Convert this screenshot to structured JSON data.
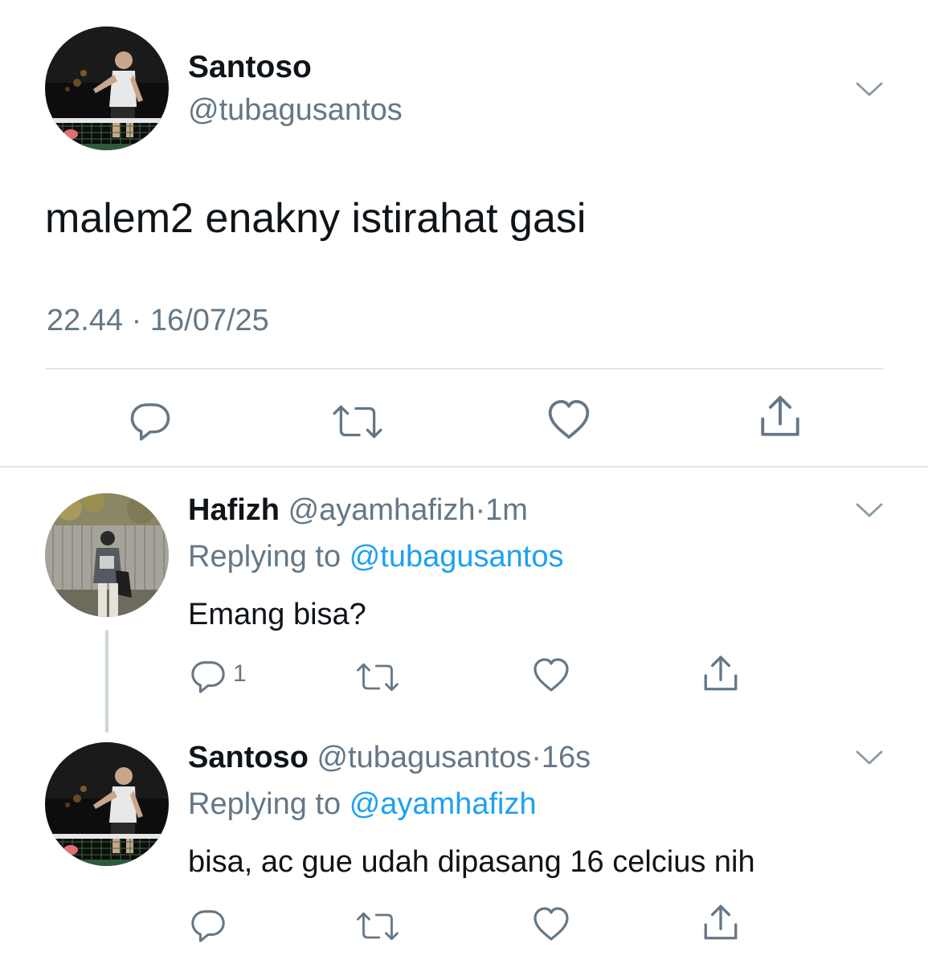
{
  "main_tweet": {
    "name": "Santoso",
    "handle": "@tubagusantos",
    "text": "malem2 enakny istirahat gasi",
    "timestamp": "22.44 · 16/07/25"
  },
  "replies": [
    {
      "name": "Hafizh",
      "handle": "@ayamhafizh",
      "separator": "·",
      "time": "1m",
      "replying_prefix": "Replying to",
      "replying_to": "@tubagusantos",
      "text": "Emang bisa?",
      "reply_count": "1"
    },
    {
      "name": "Santoso",
      "handle": "@tubagusantos",
      "separator": "·",
      "time": "16s",
      "replying_prefix": "Replying to",
      "replying_to": "@ayamhafizh",
      "text": "bisa, ac gue udah dipasang 16 celcius nih",
      "reply_count": ""
    }
  ],
  "icons": [
    "chevron-down-icon",
    "reply-icon",
    "retweet-icon",
    "like-icon",
    "share-icon"
  ],
  "colors": {
    "text": "#0f1419",
    "secondary": "#657786",
    "link": "#1da1f2",
    "divider": "#e1e8ed"
  }
}
